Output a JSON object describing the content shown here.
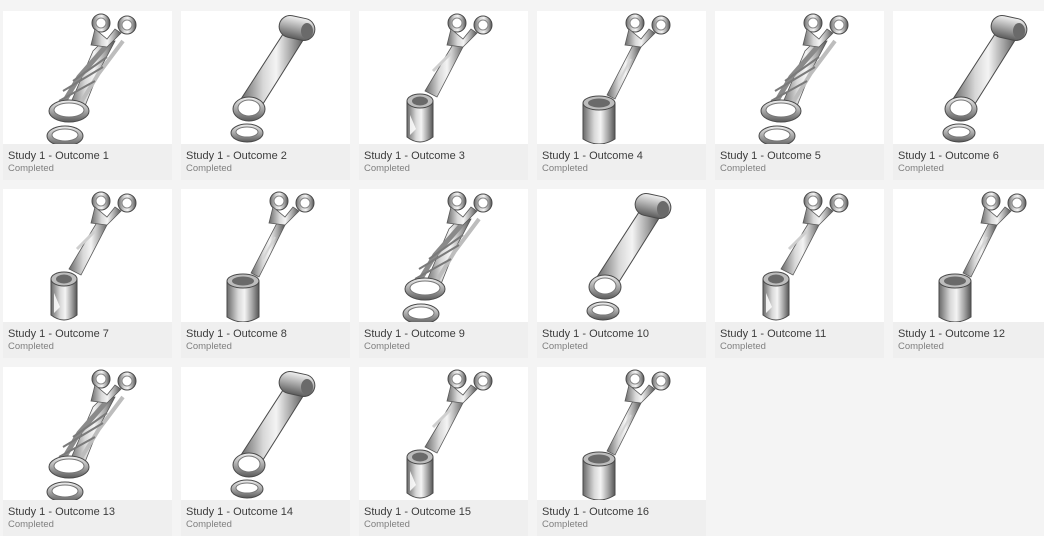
{
  "outcomes": [
    {
      "title": "Study 1 - Outcome 1",
      "status": "Completed",
      "variant": "lattice"
    },
    {
      "title": "Study 1 - Outcome 2",
      "status": "Completed",
      "variant": "arm"
    },
    {
      "title": "Study 1 - Outcome 3",
      "status": "Completed",
      "variant": "sleeve-open"
    },
    {
      "title": "Study 1 - Outcome 4",
      "status": "Completed",
      "variant": "sleeve"
    },
    {
      "title": "Study 1 - Outcome 5",
      "status": "Completed",
      "variant": "lattice"
    },
    {
      "title": "Study 1 - Outcome 6",
      "status": "Completed",
      "variant": "arm"
    },
    {
      "title": "Study 1 - Outcome 7",
      "status": "Completed",
      "variant": "sleeve-open"
    },
    {
      "title": "Study 1 - Outcome 8",
      "status": "Completed",
      "variant": "sleeve"
    },
    {
      "title": "Study 1 - Outcome 9",
      "status": "Completed",
      "variant": "lattice"
    },
    {
      "title": "Study 1 - Outcome 10",
      "status": "Completed",
      "variant": "arm"
    },
    {
      "title": "Study 1 - Outcome 11",
      "status": "Completed",
      "variant": "sleeve-open"
    },
    {
      "title": "Study 1 - Outcome 12",
      "status": "Completed",
      "variant": "sleeve"
    },
    {
      "title": "Study 1 - Outcome 13",
      "status": "Completed",
      "variant": "lattice"
    },
    {
      "title": "Study 1 - Outcome 14",
      "status": "Completed",
      "variant": "arm"
    },
    {
      "title": "Study 1 - Outcome 15",
      "status": "Completed",
      "variant": "sleeve-open"
    },
    {
      "title": "Study 1 - Outcome 16",
      "status": "Completed",
      "variant": "sleeve"
    }
  ],
  "colors": {
    "card_background": "#efefef",
    "thumbnail_background": "#ffffff",
    "title_text": "#3c3c3c",
    "status_text": "#808080",
    "metal_light": "#e9e9e9",
    "metal_dark": "#5a5a5a"
  }
}
